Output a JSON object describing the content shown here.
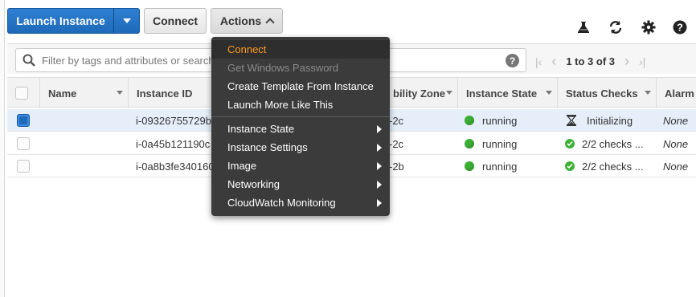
{
  "toolbar": {
    "launch_label": "Launch Instance",
    "connect_label": "Connect",
    "actions_label": "Actions",
    "icons": [
      "flask-icon",
      "refresh-icon",
      "gear-icon",
      "help-icon"
    ]
  },
  "filter": {
    "placeholder": "Filter by tags and attributes or search by keyword",
    "help": "?"
  },
  "pager": {
    "range": "1 to 3 of 3"
  },
  "table": {
    "columns": [
      "Name",
      "Instance ID",
      "Availability Zone",
      "Instance State",
      "Status Checks",
      "Alarm Status"
    ],
    "header_visible": {
      "name": "Name",
      "instance_id": "Instance ID",
      "az": "bility Zone",
      "state": "Instance State",
      "status": "Status Checks",
      "alarm": "Alarm"
    },
    "rows": [
      {
        "selected": true,
        "name": "",
        "instance_id": "i-09326755729b",
        "az": "-2c",
        "state": "running",
        "status": "Initializing",
        "status_icon": "hourglass-icon",
        "alarm": "None"
      },
      {
        "selected": false,
        "name": "",
        "instance_id": "i-0a45b121190c",
        "az": "-2c",
        "state": "running",
        "status": "2/2 checks ...",
        "status_icon": "check-circle-icon",
        "alarm": "None"
      },
      {
        "selected": false,
        "name": "",
        "instance_id": "i-0a8b3fe340160",
        "az": "-2b",
        "state": "running",
        "status": "2/2 checks ...",
        "status_icon": "check-circle-icon",
        "alarm": "None"
      }
    ]
  },
  "actions_menu": {
    "items": [
      {
        "label": "Connect",
        "state": "highlighted",
        "submenu": false
      },
      {
        "label": "Get Windows Password",
        "state": "disabled",
        "submenu": false
      },
      {
        "label": "Create Template From Instance",
        "state": "normal",
        "submenu": false
      },
      {
        "label": "Launch More Like This",
        "state": "normal",
        "submenu": false
      },
      {
        "label": "Instance State",
        "state": "normal",
        "submenu": true
      },
      {
        "label": "Instance Settings",
        "state": "normal",
        "submenu": true
      },
      {
        "label": "Image",
        "state": "normal",
        "submenu": true
      },
      {
        "label": "Networking",
        "state": "normal",
        "submenu": true
      },
      {
        "label": "CloudWatch Monitoring",
        "state": "normal",
        "submenu": true
      }
    ]
  },
  "colors": {
    "primary": "#1d6ab8",
    "menu_bg": "#3b3b3b",
    "menu_highlight": "#ff9a1f",
    "running": "#3cb034"
  }
}
